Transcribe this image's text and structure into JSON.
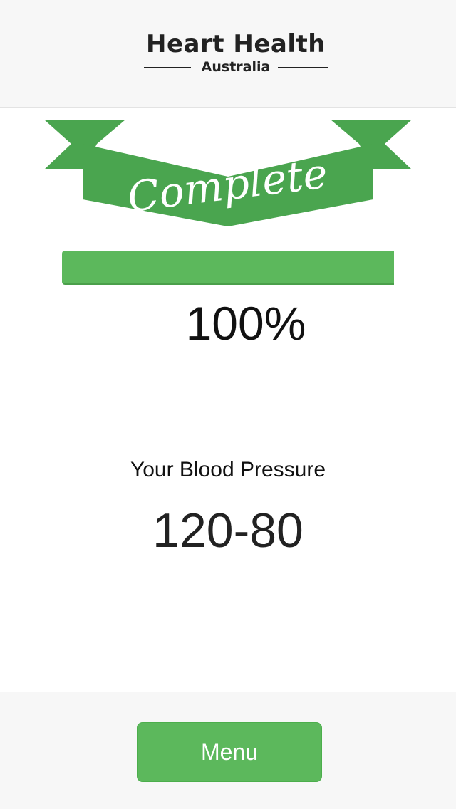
{
  "header": {
    "logo_main": "Heart Health",
    "logo_sub": "Australia"
  },
  "banner": {
    "text": "Complete",
    "color": "#4aa54f"
  },
  "progress": {
    "percent": 100,
    "label": "100%",
    "color": "#5cb85c"
  },
  "result": {
    "label": "Your Blood Pressure",
    "value": "120-80"
  },
  "footer": {
    "menu_label": "Menu"
  },
  "colors": {
    "accent": "#5cb85c",
    "header_bg": "#f7f7f7"
  }
}
